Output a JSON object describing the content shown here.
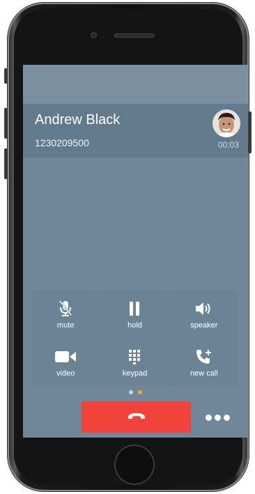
{
  "call": {
    "name": "Andrew Black",
    "number": "1230209500",
    "duration": "00:03"
  },
  "controls": [
    {
      "label": "mute",
      "icon": "mic-off-icon"
    },
    {
      "label": "hold",
      "icon": "pause-icon"
    },
    {
      "label": "speaker",
      "icon": "speaker-icon"
    },
    {
      "label": "video",
      "icon": "video-camera-icon"
    },
    {
      "label": "keypad",
      "icon": "keypad-icon"
    },
    {
      "label": "new call",
      "icon": "add-call-icon"
    }
  ],
  "pager": {
    "total": 2,
    "active": 2,
    "active_color": "#f5a623",
    "inactive_color": "#c9d3da"
  },
  "colors": {
    "end_call": "#f0413a",
    "screen_bg": "#6f8799",
    "header_bg": "#627a8c"
  }
}
